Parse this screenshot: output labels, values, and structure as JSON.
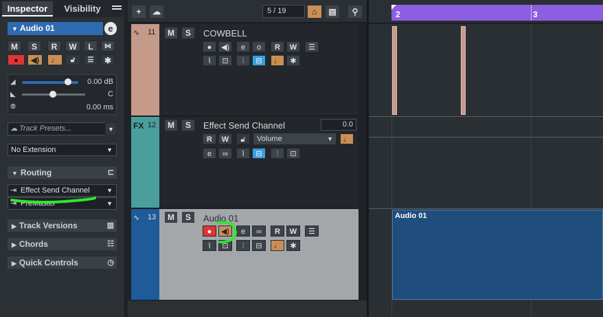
{
  "inspector": {
    "tabs": [
      "Inspector",
      "Visibility"
    ],
    "menu_icon": "hamburger-icon",
    "track_name": "Audio 01",
    "buttons_row1": [
      "M",
      "S",
      "R",
      "W",
      "L"
    ],
    "volume_value": "0.00 dB",
    "pan_value": "C",
    "delay_value": "0.00 ms",
    "track_presets_placeholder": "Track Presets...",
    "extension": "No Extension",
    "routing_label": "Routing",
    "routing_output": "Effect Send Channel",
    "routing_second": "PreMaster",
    "sections": [
      "Track Versions",
      "Chords",
      "Quick Controls"
    ]
  },
  "toolbar": {
    "counter": "5 / 19"
  },
  "tracks": [
    {
      "number": "11",
      "name": "COWBELL",
      "color": "#c59a88"
    },
    {
      "number": "12",
      "prefix": "FX",
      "name": "Effect Send Channel",
      "value": "0.0",
      "param": "Volume",
      "color": "#4a9e9c"
    },
    {
      "number": "13",
      "name": "Audio 01",
      "color": "#1f5a99"
    }
  ],
  "ruler": {
    "bar2": "2",
    "bar3": "3"
  },
  "events": {
    "audio_event_label": "Audio 01"
  },
  "colors": {
    "accent_purple": "#8c5ee0",
    "highlight_green": "#2ee82e",
    "record_red": "#e23434",
    "monitor_tan": "#c98f55",
    "selected_blue": "#2e6bb0"
  }
}
